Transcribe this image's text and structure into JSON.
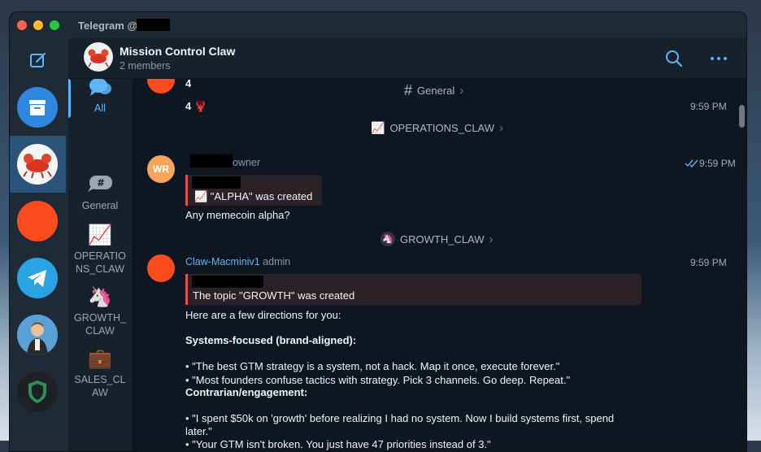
{
  "window": {
    "title": "Telegram @"
  },
  "colors": {
    "accent": "#5eb5f7",
    "sidebar_selected": "#2b5278",
    "chat_bg": "#0e1621",
    "reply_bar": "#e05252"
  },
  "folders": [
    {
      "icon": "archive-icon"
    },
    {
      "icon": "lobster-avatar"
    },
    {
      "icon": "orange-avatar"
    },
    {
      "icon": "telegram-icon"
    },
    {
      "icon": "person-avatar"
    },
    {
      "icon": "shield-icon"
    }
  ],
  "topics": {
    "all": "All",
    "general": "General",
    "operations": [
      "OPERATIO",
      "NS_CLAW"
    ],
    "growth": [
      "GROWTH_",
      "CLAW"
    ],
    "sales": [
      "SALES_CL",
      "AW"
    ]
  },
  "header": {
    "title": "Mission Control Claw",
    "subtitle": "2 members"
  },
  "messages": {
    "top_line1": "4",
    "top_line2": "4 🦞",
    "top_time": "9:59 PM",
    "sep_general": "General",
    "sep_operations": "OPERATIONS_CLAW",
    "m1": {
      "initials": "WR",
      "role": "owner",
      "time": "9:59 PM",
      "reply_text": "📈 \"ALPHA\" was created",
      "text": "Any memecoin alpha?"
    },
    "sep_growth": "GROWTH_CLAW",
    "m2": {
      "sender": "Claw-Macminiv1",
      "role": "admin",
      "time": "9:59 PM",
      "reply_text": "The topic \"GROWTH\" was created",
      "lines": [
        "Here are a few directions for you:",
        "Systems-focused (brand-aligned):",
        "• \"The best GTM strategy is a system, not a hack. Map it once, execute forever.\"",
        "• \"Most founders confuse tactics with strategy. Pick 3 channels. Go deep. Repeat.\"",
        "Contrarian/engagement:",
        "• \"I spent $50k on 'growth' before realizing I had no system. Now I build systems first, spend",
        "later.\"",
        "• \"Your GTM isn't broken. You just have 47 priorities instead of 3.\""
      ]
    }
  }
}
